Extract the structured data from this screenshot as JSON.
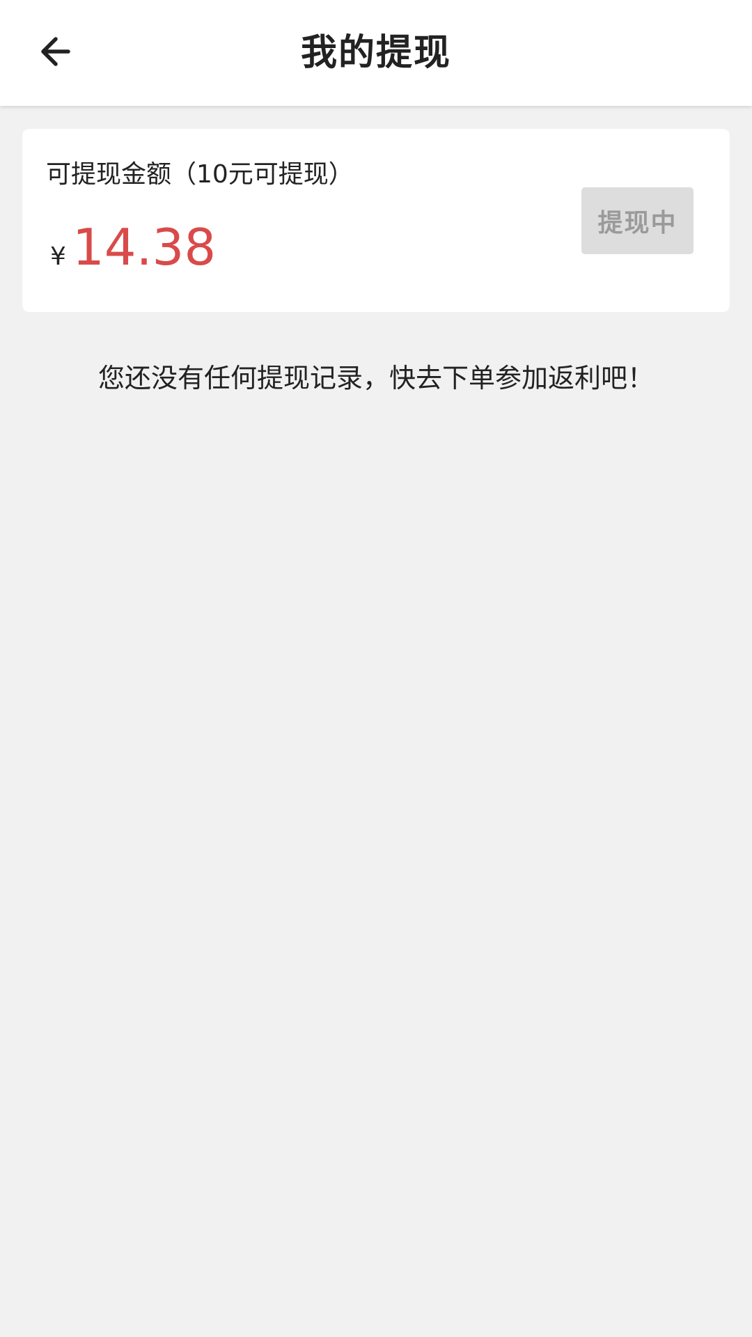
{
  "header": {
    "title": "我的提现",
    "back_icon": "arrow-left-icon"
  },
  "balance_card": {
    "label": "可提现金额（10元可提现）",
    "currency_symbol": "¥",
    "amount": "14.38",
    "amount_color": "#d94a4a",
    "withdraw_button_label": "提现中",
    "withdraw_button_state": "disabled"
  },
  "records": {
    "empty_message": "您还没有任何提现记录，快去下单参加返利吧！"
  },
  "colors": {
    "background": "#f1f1f1",
    "card": "#ffffff",
    "button_disabled_bg": "#dddddd",
    "button_disabled_text": "#9a9a9a"
  }
}
